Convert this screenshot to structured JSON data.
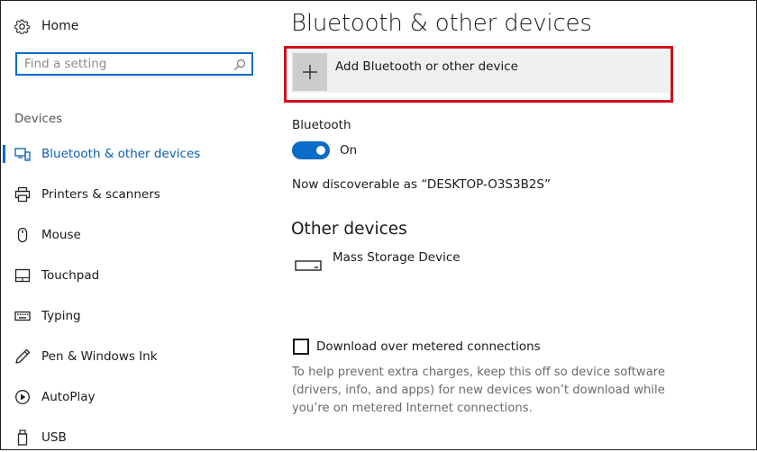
{
  "sidebar": {
    "home_label": "Home",
    "search": {
      "placeholder": "Find a setting",
      "value": ""
    },
    "section_label": "Devices",
    "items": [
      {
        "id": "bluetooth",
        "label": "Bluetooth & other devices",
        "icon": "bluetooth-devices-icon",
        "active": true
      },
      {
        "id": "printers",
        "label": "Printers & scanners",
        "icon": "printer-icon",
        "active": false
      },
      {
        "id": "mouse",
        "label": "Mouse",
        "icon": "mouse-icon",
        "active": false
      },
      {
        "id": "touchpad",
        "label": "Touchpad",
        "icon": "touchpad-icon",
        "active": false
      },
      {
        "id": "typing",
        "label": "Typing",
        "icon": "keyboard-icon",
        "active": false
      },
      {
        "id": "pen",
        "label": "Pen & Windows Ink",
        "icon": "pen-icon",
        "active": false
      },
      {
        "id": "autoplay",
        "label": "AutoPlay",
        "icon": "autoplay-icon",
        "active": false
      },
      {
        "id": "usb",
        "label": "USB",
        "icon": "usb-icon",
        "active": false
      }
    ]
  },
  "main": {
    "title": "Bluetooth & other devices",
    "add_device_label": "Add Bluetooth or other device",
    "bluetooth": {
      "label": "Bluetooth",
      "toggle_on": true,
      "state_label": "On",
      "discoverable_text": "Now discoverable as “DESKTOP-O3S3B2S”"
    },
    "other_devices": {
      "heading": "Other devices",
      "devices": [
        {
          "name": "Mass Storage Device",
          "icon": "drive-icon"
        }
      ]
    },
    "metered": {
      "checked": false,
      "label": "Download over metered connections",
      "help_lines": [
        "To help prevent extra charges, keep this off so device software",
        "(drivers, info, and apps) for new devices won’t download while",
        "you’re on metered Internet connections."
      ]
    }
  },
  "colors": {
    "accent": "#0a6cc9",
    "highlight_border": "#d0101a"
  }
}
